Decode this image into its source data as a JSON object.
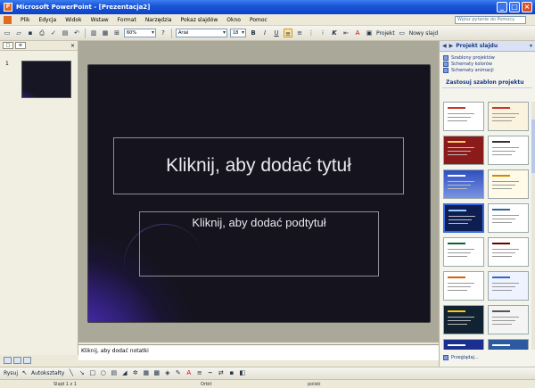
{
  "window": {
    "title": "Microsoft PowerPoint - [Prezentacja2]",
    "minimize": "_",
    "maximize": "□",
    "close": "×"
  },
  "menu": {
    "items": [
      "Plik",
      "Edycja",
      "Widok",
      "Wstaw",
      "Format",
      "Narzędzia",
      "Pokaz slajdów",
      "Okno",
      "Pomoc"
    ],
    "help_placeholder": "Wpisz pytanie do Pomocy"
  },
  "toolbar": {
    "zoom": "60%",
    "font": "Arial",
    "font_size": "18",
    "bold": "B",
    "italic": "I",
    "underline": "U",
    "font_color": "A",
    "design_label": "Projekt",
    "new_slide_label": "Nowy slajd"
  },
  "thumbnails": {
    "tab_slides": "□",
    "tab_outline": "≡",
    "close": "×",
    "slide_number": "1"
  },
  "slide": {
    "title_placeholder": "Kliknij, aby dodać tytuł",
    "subtitle_placeholder": "Kliknij, aby dodać podtytuł"
  },
  "notes": {
    "placeholder": "Kliknij, aby dodać notatki"
  },
  "drawing": {
    "draw_label": "Rysuj",
    "autoshapes_label": "Autokształty"
  },
  "status": {
    "slide": "Slajd 1 z 1",
    "design": "Orbit",
    "language": "polski"
  },
  "taskpane": {
    "title": "Projekt slajdu",
    "links": [
      "Szablony projektów",
      "Schematy kolorów",
      "Schematy animacji"
    ],
    "section": "Zastosuj szablon projektu",
    "footer_link": "Przeglądaj..."
  },
  "colors": {
    "slide_bg": "#15141e",
    "accent_swirl": "#5534d6",
    "titlebar": "#1c56d8"
  }
}
